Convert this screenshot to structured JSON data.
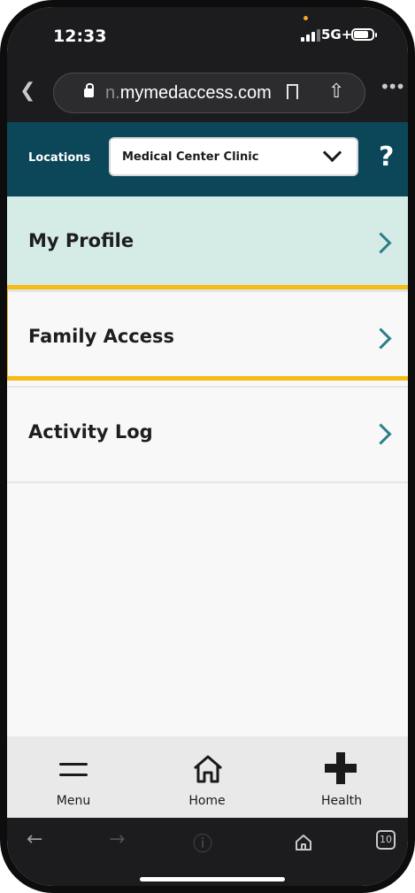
{
  "status_bar": {
    "time": "12:33",
    "network": "5G+"
  },
  "browser": {
    "url_prefix": "n.",
    "url_domain": "mymedaccess.com",
    "tab_count": "10"
  },
  "header": {
    "locations_label": "Locations",
    "selected_location": "Medical Center Clinic",
    "help_label": "?"
  },
  "menu": {
    "items": [
      {
        "label": "My Profile",
        "selected": true
      },
      {
        "label": "Family Access",
        "highlighted": true
      },
      {
        "label": "Activity Log"
      }
    ]
  },
  "bottom_nav": {
    "items": [
      {
        "label": "Menu",
        "icon": "hamburger-icon"
      },
      {
        "label": "Home",
        "icon": "home-icon"
      },
      {
        "label": "Health",
        "icon": "plus-icon"
      }
    ]
  },
  "colors": {
    "header_bg": "#0b4659",
    "selected_row_bg": "#d4ebe6",
    "chevron": "#2a7f86",
    "highlight_border": "#f6bb14"
  }
}
